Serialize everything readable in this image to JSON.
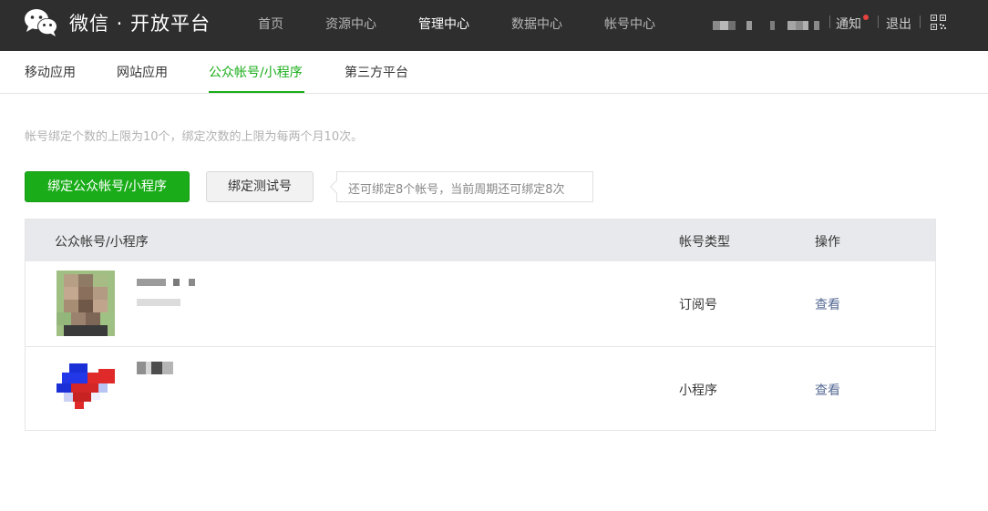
{
  "brand": {
    "title": "微信 · 开放平台",
    "logo_icon": "wechat-logo-icon"
  },
  "nav": {
    "items": [
      {
        "label": "首页",
        "active": false
      },
      {
        "label": "资源中心",
        "active": false
      },
      {
        "label": "管理中心",
        "active": true
      },
      {
        "label": "数据中心",
        "active": false
      },
      {
        "label": "帐号中心",
        "active": false
      }
    ]
  },
  "user": {
    "notify_label": "通知",
    "logout_label": "退出",
    "qr_icon": "qrcode-icon"
  },
  "subtabs": {
    "items": [
      {
        "label": "移动应用",
        "active": false
      },
      {
        "label": "网站应用",
        "active": false
      },
      {
        "label": "公众帐号/小程序",
        "active": true
      },
      {
        "label": "第三方平台",
        "active": false
      }
    ]
  },
  "notice": "帐号绑定个数的上限为10个，绑定次数的上限为每两个月10次。",
  "actions": {
    "bind_label": "绑定公众帐号/小程序",
    "test_label": "绑定测试号",
    "tip": "还可绑定8个帐号，当前周期还可绑定8次"
  },
  "table": {
    "headers": {
      "account": "公众帐号/小程序",
      "type": "帐号类型",
      "action": "操作"
    },
    "rows": [
      {
        "type": "订阅号",
        "action": "查看"
      },
      {
        "type": "小程序",
        "action": "查看"
      }
    ]
  },
  "colors": {
    "accent": "#1aad19",
    "link": "#576b95",
    "topbar": "#2e2e2e"
  }
}
